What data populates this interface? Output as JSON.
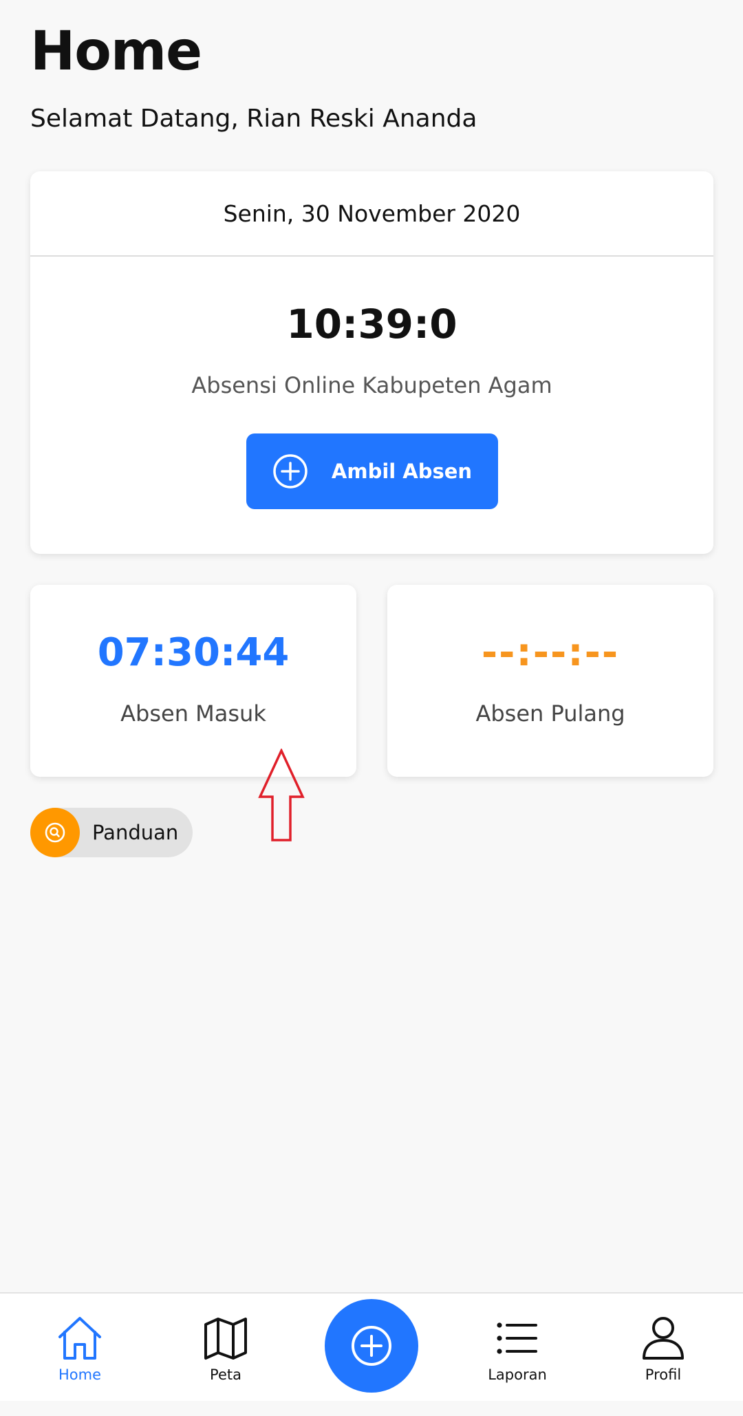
{
  "header": {
    "title": "Home",
    "welcome": "Selamat Datang, Rian Reski Ananda"
  },
  "main_card": {
    "date": "Senin, 30 November 2020",
    "clock": "10:39:0",
    "app_name": "Absensi Online Kabupeten Agam",
    "button_label": "Ambil Absen",
    "button_icon": "plus-circle-icon"
  },
  "attendance": {
    "in": {
      "time": "07:30:44",
      "label": "Absen Masuk"
    },
    "out": {
      "time": "--:--:--",
      "label": "Absen Pulang"
    }
  },
  "guide": {
    "label": "Panduan",
    "icon": "search-icon"
  },
  "annotation": {
    "icon": "red-arrow-up-icon"
  },
  "bottom_nav": {
    "items": [
      {
        "label": "Home",
        "icon": "home-icon",
        "active": true
      },
      {
        "label": "Peta",
        "icon": "map-icon",
        "active": false
      },
      {
        "label": "",
        "icon": "add-circle-icon",
        "active": false
      },
      {
        "label": "Laporan",
        "icon": "list-icon",
        "active": false
      },
      {
        "label": "Profil",
        "icon": "user-icon",
        "active": false
      }
    ]
  },
  "colors": {
    "primary": "#2176ff",
    "accent_orange": "#f7951e",
    "panduan_orange": "#ff9800",
    "background": "#f8f8f8",
    "annotation_red": "#e0202a"
  }
}
